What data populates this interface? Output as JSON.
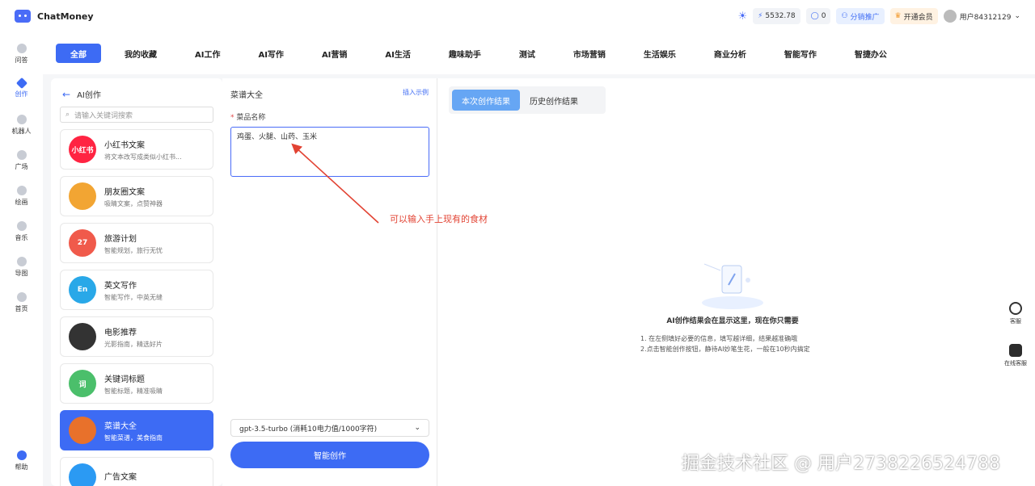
{
  "topbar": {
    "app_name": "ChatMoney",
    "balance": "5532.78",
    "coins": "0",
    "distribution": "分销推广",
    "vip": "开通会员",
    "user": "用户84312129"
  },
  "nav": {
    "qa": "问答",
    "create": "创作",
    "robot": "机器人",
    "square": "广场",
    "draw": "绘画",
    "music": "音乐",
    "mindmap": "导图",
    "home": "首页",
    "help": "帮助"
  },
  "tabs": [
    "全部",
    "我的收藏",
    "AI工作",
    "AI写作",
    "AI营销",
    "AI生活",
    "趣味助手",
    "测试",
    "市场营销",
    "生活娱乐",
    "商业分析",
    "智能写作",
    "智捷办公"
  ],
  "app_list": {
    "back_label": "AI创作",
    "search_placeholder": "请输入关键词搜索",
    "items": [
      {
        "title": "小红书文案",
        "desc": "将文本改写成类似小红书...",
        "icon_text": "小红书",
        "color": "#ff2442"
      },
      {
        "title": "朋友圈文案",
        "desc": "吸睛文案，点赞神器",
        "icon_text": "",
        "color": "#f2a533"
      },
      {
        "title": "旅游计划",
        "desc": "智能规划，旅行无忧",
        "icon_text": "27",
        "color": "#f05a4b"
      },
      {
        "title": "英文写作",
        "desc": "智能写作，中英无缝",
        "icon_text": "En",
        "color": "#29a8e8"
      },
      {
        "title": "电影推荐",
        "desc": "光影指南，精选好片",
        "icon_text": "",
        "color": "#333333"
      },
      {
        "title": "关键词标题",
        "desc": "智能标题，精准吸睛",
        "icon_text": "词",
        "color": "#4bbf6b"
      },
      {
        "title": "菜谱大全",
        "desc": "智能菜谱，美食指南",
        "icon_text": "",
        "color": "#e8712b"
      },
      {
        "title": "广告文案",
        "desc": "",
        "icon_text": "",
        "color": "#2b9af3"
      }
    ]
  },
  "form": {
    "title": "菜谱大全",
    "insert_example": "插入示例",
    "field_label": "菜品名称",
    "field_value": "鸡蛋、火腿、山药、玉米",
    "model": "gpt-3.5-turbo (消耗10电力值/1000字符)",
    "submit": "智能创作"
  },
  "result": {
    "tab_current": "本次创作结果",
    "tab_history": "历史创作结果",
    "empty_title": "AI创作结果会在显示这里，现在你只需要",
    "hint_1": "1. 在左侧填好必要的信息，填写越详细，结果越准确哦",
    "hint_2": "2.点击智能创作按钮，静待AI妙笔生花，一般在10秒内搞定"
  },
  "annotation": "可以输入手上现有的食材",
  "float": {
    "service": "客服",
    "online_service": "在线客服"
  },
  "watermark": "掘金技术社区 @ 用户2738226524788",
  "colors": {
    "accent": "#3d6bf4",
    "annotation": "#e24333"
  }
}
